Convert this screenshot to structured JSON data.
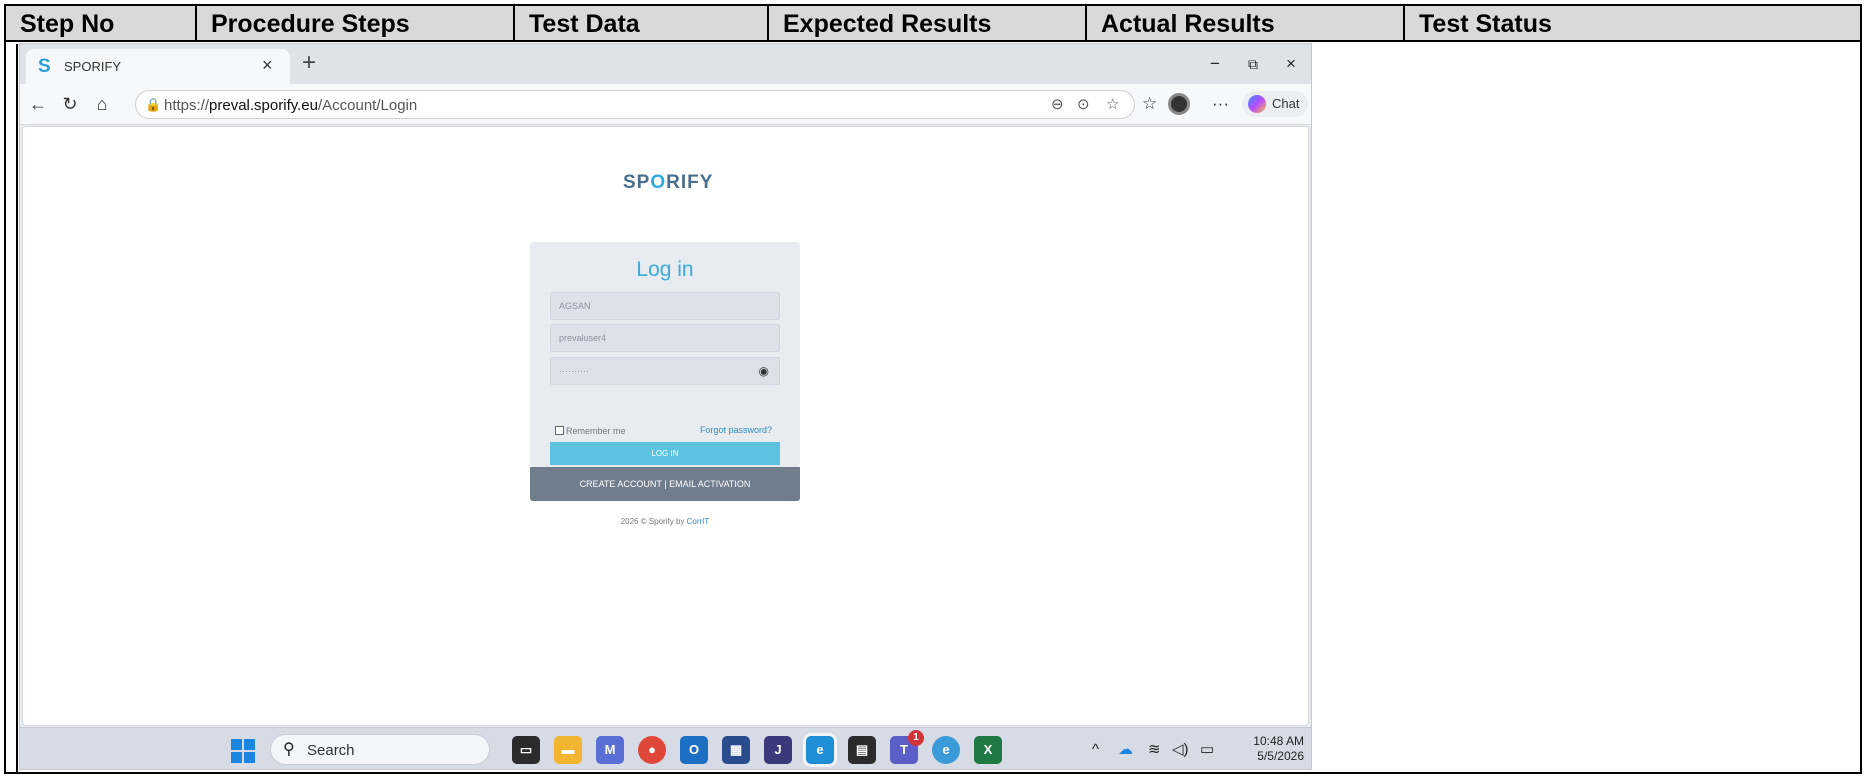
{
  "table": {
    "columns": [
      "Step No",
      "Procedure Steps",
      "Test Data",
      "Expected Results",
      "Actual Results",
      "Test Status"
    ]
  },
  "browser": {
    "tab_logo": "S",
    "tab_title": "SPORIFY",
    "tab_close": "×",
    "new_tab": "+",
    "url_host_prefix": "https://",
    "url_host": "preval.sporify.eu",
    "url_path": "/Account/Login",
    "chat_label": "Chat",
    "window": {
      "minimize": "−",
      "restore": "⧉",
      "close": "×"
    }
  },
  "page": {
    "brand_prefix": "SP",
    "brand_accent": "O",
    "brand_suffix": "RIFY",
    "login_title": "Log in",
    "company_value": "AGSAN",
    "username_value": "prevaluser4",
    "password_value": "··········",
    "remember_label": "Remember me",
    "forgot_label": "Forgot password?",
    "login_button": "LOG IN",
    "footer_links": "CREATE ACCOUNT | EMAIL ACTIVATION",
    "copyright_prefix": "2026 © Sporify by ",
    "copyright_link": "CorrIT"
  },
  "taskbar": {
    "search_label": "Search",
    "time": "10:48 AM",
    "date": "5/5/2026",
    "teams_badge": "1"
  },
  "colors": {
    "accent": "#3aa9dc",
    "login_button": "#5bc3df",
    "card_footer": "#707d8c",
    "header_fill": "#d9d9d9"
  }
}
